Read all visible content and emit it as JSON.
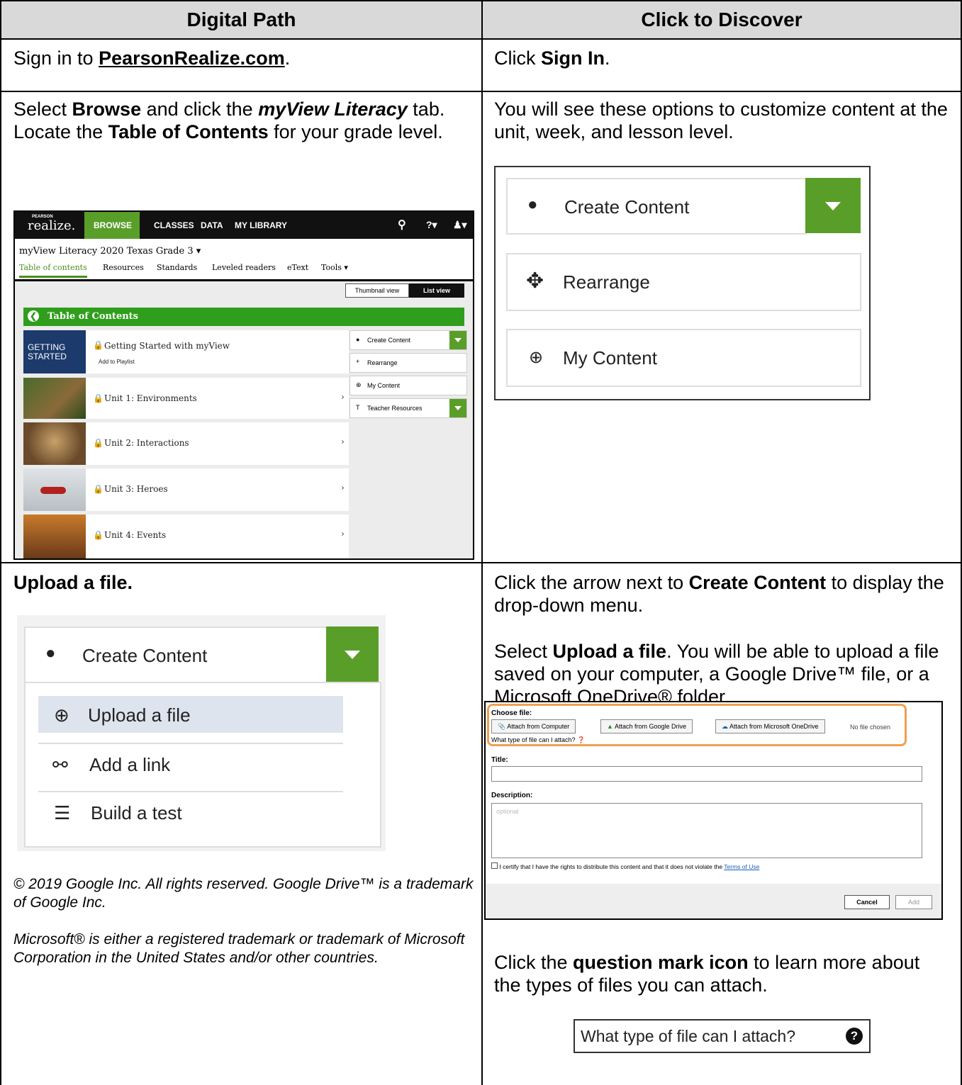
{
  "table": {
    "header_left": "Digital Path",
    "header_right": "Click to Discover"
  },
  "row1": {
    "left_pre": "Sign in to ",
    "left_link": "PearsonRealize.com",
    "left_post": ".",
    "right_pre": "Click ",
    "right_bold": "Sign In",
    "right_post": "."
  },
  "row2": {
    "left_p1_a": "Select ",
    "left_p1_b": "Browse",
    "left_p1_c": " and click the ",
    "left_p1_d": "myView Literacy",
    "left_p1_e": " tab.",
    "left_p2_a": "Locate the ",
    "left_p2_b": "Table of Contents",
    "left_p2_c": " for your grade level.",
    "right_text": "You will see these options to customize content at the unit, week, and lesson level."
  },
  "realize": {
    "brand_small": "PEARSON",
    "brand": "realize.",
    "nav": [
      "BROWSE",
      "CLASSES",
      "DATA",
      "MY LIBRARY"
    ],
    "product": "myView Literacy 2020 Texas Grade 3 ▾",
    "tabs": [
      "Table of contents",
      "Resources",
      "Standards",
      "Leveled readers",
      "eText",
      "Tools ▾"
    ],
    "view_thumb": "Thumbnail view",
    "view_list": "List view",
    "toc_title": "Table of Contents",
    "getting_started_thumb": "GETTING STARTED",
    "items": [
      "Getting Started with myView",
      "Unit 1: Environments",
      "Unit 2: Interactions",
      "Unit 3: Heroes",
      "Unit 4: Events"
    ],
    "add_playlist": "Add to Playlist",
    "side": [
      "Create Content",
      "Rearrange",
      "My Content",
      "Teacher Resources"
    ]
  },
  "options_panel": {
    "create": "Create Content",
    "rearrange": "Rearrange",
    "my_content": "My Content"
  },
  "row3": {
    "left_title": "Upload a file.",
    "right_p1_a": "Click the arrow next to ",
    "right_p1_b": "Create Content",
    "right_p1_c": " to display the drop-down menu.",
    "right_p2_a": "Select ",
    "right_p2_b": "Upload a file",
    "right_p2_c": ". You will be able to upload a file saved on your computer, a Google Drive™ file, or a Microsoft OneDrive® folder.",
    "right_p3_a": "Click the ",
    "right_p3_b": "question mark icon",
    "right_p3_c": " to learn more about the types of files you can attach.",
    "legal1": "© 2019 Google Inc. All rights reserved. Google Drive™ is a trademark of Google Inc.",
    "legal2": "Microsoft® is either a registered trademark or trademark of Microsoft Corporation in the United States and/or other countries."
  },
  "menu_panel": {
    "create": "Create Content",
    "items": [
      "Upload a file",
      "Add a link",
      "Build a test"
    ]
  },
  "form": {
    "choose": "Choose file:",
    "btn_computer": "Attach from Computer",
    "btn_google": "Attach from Google Drive",
    "btn_onedrive": "Attach from Microsoft OneDrive",
    "no_file": "No file chosen",
    "what_type": "What type of file can I attach?",
    "title_label": "Title:",
    "desc_label": "Description:",
    "desc_placeholder": "optional",
    "certify": "I certify that I have the rights to distribute this content and that it does not violate the ",
    "terms": "Terms of Use",
    "cancel": "Cancel",
    "add": "Add"
  },
  "qbox": {
    "text": "What type of file can I attach?"
  }
}
